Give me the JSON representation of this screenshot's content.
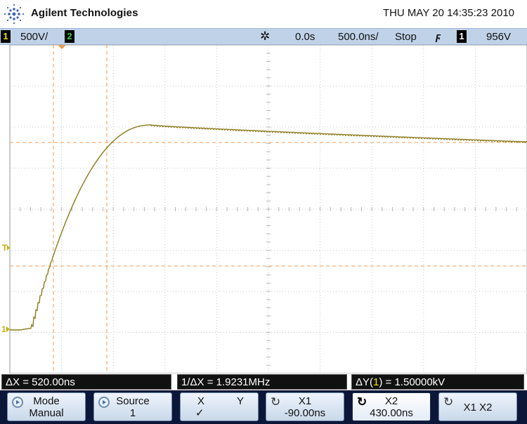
{
  "header": {
    "brand": "Agilent Technologies",
    "datetime": "THU MAY 20 14:35:23 2010"
  },
  "status": {
    "ch1_label": "1",
    "ch1_scale": "500V/",
    "ch2_label": "2",
    "run_icon": "sun-icon",
    "time_offset": "0.0s",
    "time_scale": "500.0ns/",
    "run_state": "Stop",
    "trigger_slope": "ϝ",
    "trigger_source": "1",
    "trigger_level": "956V"
  },
  "screen": {
    "grid": true,
    "trigger_marker": "T",
    "ground_marker": "1",
    "waveform_color": "#8a7a1a",
    "cursor_color": "#f0a050"
  },
  "measurements": {
    "delta_x": "ΔX = 520.00ns",
    "inv_delta_x": "1/ΔX = 1.9231MHz",
    "delta_y_prefix": "ΔY(",
    "delta_y_ch": "1",
    "delta_y_suffix": ") = 1.50000kV"
  },
  "softkeys": {
    "mode_title": "Mode",
    "mode_value": "Manual",
    "source_title": "Source",
    "source_value": "1",
    "x_label": "X",
    "y_label": "Y",
    "x_check": "✓",
    "x1_title": "X1",
    "x1_value": "-90.00ns",
    "x2_title": "X2",
    "x2_value": "430.00ns",
    "x1x2_label": "X1 X2"
  }
}
